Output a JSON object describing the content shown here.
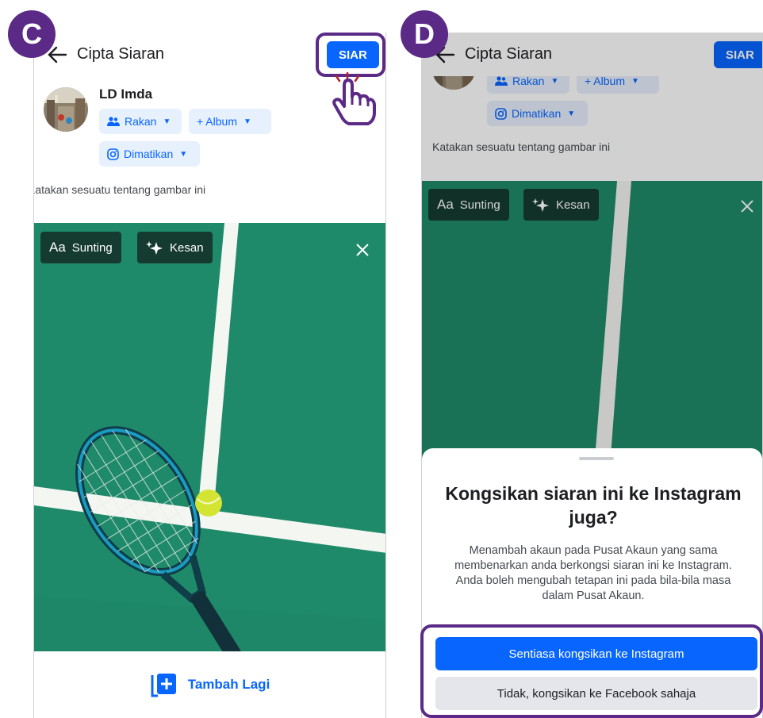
{
  "panels": {
    "c": {
      "badge": "C",
      "title": "Cipta Siaran",
      "post_button": "SIAR",
      "user_name": "LD Imda",
      "audience_chip": "Rakan",
      "album_chip": "+ Album",
      "instagram_chip": "Dimatikan",
      "caption_placeholder": "Katakan sesuatu tentang gambar ini",
      "edit_button": "Sunting",
      "edit_prefix": "Aa",
      "effects_button": "Kesan",
      "add_more": "Tambah Lagi"
    },
    "d": {
      "badge": "D",
      "title": "Cipta Siaran",
      "post_button": "SIAR",
      "audience_chip": "Rakan",
      "album_chip": "+ Album",
      "instagram_chip": "Dimatikan",
      "caption_placeholder": "Katakan sesuatu tentang gambar ini",
      "edit_button": "Sunting",
      "edit_prefix": "Aa",
      "effects_button": "Kesan",
      "sheet": {
        "title": "Kongsikan siaran ini ke Instagram juga?",
        "body": "Menambah akaun pada Pusat Akaun yang sama membenarkan anda berkongsi siaran ini ke Instagram. Anda boleh mengubah tetapan ini pada bila-bila masa dalam Pusat Akaun.",
        "primary_button": "Sentiasa kongsikan ke Instagram",
        "secondary_button": "Tidak, kongsikan ke Facebook sahaja"
      }
    }
  },
  "colors": {
    "accent": "#0866ff",
    "highlight": "#5b2a86",
    "court_green": "#1f8a6a"
  },
  "icons": [
    "back-arrow-icon",
    "friends-icon",
    "caret-down-icon",
    "instagram-icon",
    "sparkle-icon",
    "close-icon",
    "add-photo-icon",
    "pointing-hand-icon"
  ]
}
